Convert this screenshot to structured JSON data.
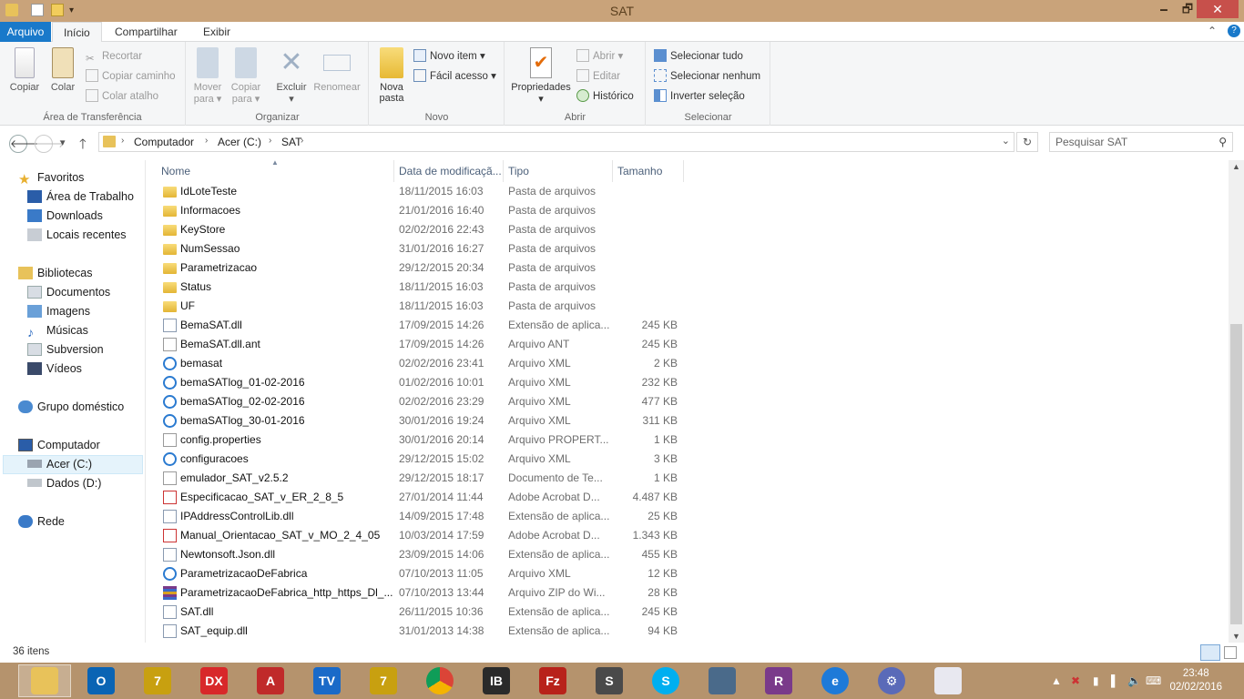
{
  "window": {
    "title": "SAT",
    "minimize": "🗕",
    "maximize": "🗗",
    "close": "✕"
  },
  "tabs": [
    {
      "label": "Arquivo"
    },
    {
      "label": "Início"
    },
    {
      "label": "Compartilhar"
    },
    {
      "label": "Exibir"
    }
  ],
  "ribbon": {
    "clipboard": {
      "group": "Área de Transferência",
      "copy": "Copiar",
      "paste": "Colar",
      "cut": "Recortar",
      "copy_path": "Copiar caminho",
      "paste_shortcut": "Colar atalho"
    },
    "organize": {
      "group": "Organizar",
      "move_to_1": "Mover",
      "move_to_2": "para ▾",
      "copy_to_1": "Copiar",
      "copy_to_2": "para ▾",
      "delete": "Excluir",
      "delete_arrow": "▾",
      "rename": "Renomear"
    },
    "new": {
      "group": "Novo",
      "new_folder_1": "Nova",
      "new_folder_2": "pasta",
      "new_item": "Novo item ▾",
      "easy_access": "Fácil acesso ▾"
    },
    "open": {
      "group": "Abrir",
      "properties": "Propriedades",
      "properties_arrow": "▾",
      "open": "Abrir ▾",
      "edit": "Editar",
      "history": "Histórico"
    },
    "select": {
      "group": "Selecionar",
      "select_all": "Selecionar tudo",
      "select_none": "Selecionar nenhum",
      "invert": "Inverter seleção"
    }
  },
  "address": {
    "back": "🡐",
    "forward": "🡒",
    "recent": "▾",
    "up": "🡑",
    "crumbs": [
      "Computador",
      "Acer (C:)",
      "SAT"
    ],
    "search_placeholder": "Pesquisar SAT"
  },
  "navpane": {
    "favorites": "Favoritos",
    "desktop": "Área de Trabalho",
    "downloads": "Downloads",
    "recent": "Locais recentes",
    "libraries": "Bibliotecas",
    "documents": "Documentos",
    "pictures": "Imagens",
    "music": "Músicas",
    "subversion": "Subversion",
    "videos": "Vídeos",
    "homegroup": "Grupo doméstico",
    "computer": "Computador",
    "drive_c": "Acer (C:)",
    "drive_d": "Dados (D:)",
    "network": "Rede"
  },
  "columns": {
    "name": "Nome",
    "date": "Data de modificaçã...",
    "type": "Tipo",
    "size": "Tamanho"
  },
  "files": [
    {
      "name": "IdLoteTeste",
      "date": "18/11/2015 16:03",
      "type": "Pasta de arquivos",
      "size": "",
      "icon": "folder"
    },
    {
      "name": "Informacoes",
      "date": "21/01/2016 16:40",
      "type": "Pasta de arquivos",
      "size": "",
      "icon": "folder"
    },
    {
      "name": "KeyStore",
      "date": "02/02/2016 22:43",
      "type": "Pasta de arquivos",
      "size": "",
      "icon": "folder"
    },
    {
      "name": "NumSessao",
      "date": "31/01/2016 16:27",
      "type": "Pasta de arquivos",
      "size": "",
      "icon": "folder"
    },
    {
      "name": "Parametrizacao",
      "date": "29/12/2015 20:34",
      "type": "Pasta de arquivos",
      "size": "",
      "icon": "folder"
    },
    {
      "name": "Status",
      "date": "18/11/2015 16:03",
      "type": "Pasta de arquivos",
      "size": "",
      "icon": "folder"
    },
    {
      "name": "UF",
      "date": "18/11/2015 16:03",
      "type": "Pasta de arquivos",
      "size": "",
      "icon": "folder"
    },
    {
      "name": "BemaSAT.dll",
      "date": "17/09/2015 14:26",
      "type": "Extensão de aplica...",
      "size": "245 KB",
      "icon": "dll"
    },
    {
      "name": "BemaSAT.dll.ant",
      "date": "17/09/2015 14:26",
      "type": "Arquivo ANT",
      "size": "245 KB",
      "icon": "file"
    },
    {
      "name": "bemasat",
      "date": "02/02/2016 23:41",
      "type": "Arquivo XML",
      "size": "2 KB",
      "icon": "xml"
    },
    {
      "name": "bemaSATlog_01-02-2016",
      "date": "01/02/2016 10:01",
      "type": "Arquivo XML",
      "size": "232 KB",
      "icon": "xml"
    },
    {
      "name": "bemaSATlog_02-02-2016",
      "date": "02/02/2016 23:29",
      "type": "Arquivo XML",
      "size": "477 KB",
      "icon": "xml"
    },
    {
      "name": "bemaSATlog_30-01-2016",
      "date": "30/01/2016 19:24",
      "type": "Arquivo XML",
      "size": "311 KB",
      "icon": "xml"
    },
    {
      "name": "config.properties",
      "date": "30/01/2016 20:14",
      "type": "Arquivo PROPERT...",
      "size": "1 KB",
      "icon": "file"
    },
    {
      "name": "configuracoes",
      "date": "29/12/2015 15:02",
      "type": "Arquivo XML",
      "size": "3 KB",
      "icon": "xml"
    },
    {
      "name": "emulador_SAT_v2.5.2",
      "date": "29/12/2015 18:17",
      "type": "Documento de Te...",
      "size": "1 KB",
      "icon": "txt"
    },
    {
      "name": "Especificacao_SAT_v_ER_2_8_5",
      "date": "27/01/2014 11:44",
      "type": "Adobe Acrobat D...",
      "size": "4.487 KB",
      "icon": "pdf"
    },
    {
      "name": "IPAddressControlLib.dll",
      "date": "14/09/2015 17:48",
      "type": "Extensão de aplica...",
      "size": "25 KB",
      "icon": "dll"
    },
    {
      "name": "Manual_Orientacao_SAT_v_MO_2_4_05",
      "date": "10/03/2014 17:59",
      "type": "Adobe Acrobat D...",
      "size": "1.343 KB",
      "icon": "pdf"
    },
    {
      "name": "Newtonsoft.Json.dll",
      "date": "23/09/2015 14:06",
      "type": "Extensão de aplica...",
      "size": "455 KB",
      "icon": "dll"
    },
    {
      "name": "ParametrizacaoDeFabrica",
      "date": "07/10/2013 11:05",
      "type": "Arquivo XML",
      "size": "12 KB",
      "icon": "xml"
    },
    {
      "name": "ParametrizacaoDeFabrica_http_https_Dl_...",
      "date": "07/10/2013 13:44",
      "type": "Arquivo ZIP do Wi...",
      "size": "28 KB",
      "icon": "zip"
    },
    {
      "name": "SAT.dll",
      "date": "26/11/2015 10:36",
      "type": "Extensão de aplica...",
      "size": "245 KB",
      "icon": "dll"
    },
    {
      "name": "SAT_equip.dll",
      "date": "31/01/2013 14:38",
      "type": "Extensão de aplica...",
      "size": "94 KB",
      "icon": "dll"
    }
  ],
  "status": {
    "count": "36 itens"
  },
  "taskbar": {
    "apps": [
      "file-explorer",
      "outlook",
      "7zip-like",
      "dx",
      "acrobat-like",
      "teamviewer",
      "7zip",
      "chrome",
      "ib",
      "filezilla",
      "sublime",
      "skype",
      "remote-desktop",
      "winrar",
      "internet-explorer",
      "settings",
      "paint"
    ],
    "time": "23:48",
    "date": "02/02/2016"
  }
}
